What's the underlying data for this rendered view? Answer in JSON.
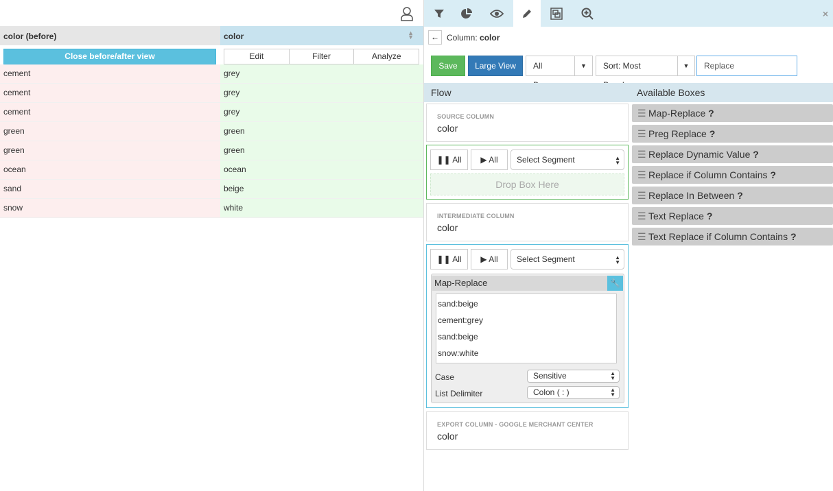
{
  "table": {
    "headers": [
      "color (before)",
      "color"
    ],
    "close_label": "Close before/after view",
    "actions": [
      "Edit",
      "Filter",
      "Analyze"
    ],
    "rows": [
      [
        "cement",
        "grey"
      ],
      [
        "cement",
        "grey"
      ],
      [
        "cement",
        "grey"
      ],
      [
        "green",
        "green"
      ],
      [
        "green",
        "green"
      ],
      [
        "ocean",
        "ocean"
      ],
      [
        "sand",
        "beige"
      ],
      [
        "snow",
        "white"
      ]
    ]
  },
  "panel": {
    "tabs": [
      "filter-icon",
      "pie-chart-icon",
      "eye-icon",
      "pencil-icon",
      "crop-icon",
      "zoom-in-icon"
    ],
    "close": "×",
    "column_label": "Column:",
    "column_name": "color",
    "save": "Save",
    "large_view": "Large View",
    "all_boxes": "All Boxes",
    "sort": "Sort: Most Popular",
    "search_value": "Replace",
    "flow": "Flow",
    "available": "Available Boxes",
    "source_label": "SOURCE COLUMN",
    "source_value": "color",
    "pause_all": "All",
    "play_all": "All",
    "select_segment": "Select Segment",
    "drop": "Drop Box Here",
    "intermediate_label": "INTERMEDIATE COLUMN",
    "intermediate_value": "color",
    "box_title": "Map-Replace",
    "map_lines": [
      "sand:beige",
      "cement:grey",
      "sand:beige",
      "snow:white"
    ],
    "case_label": "Case",
    "case_value": "Sensitive",
    "delim_label": "List Delimiter",
    "delim_value": "Colon ( : )",
    "export_label": "EXPORT COLUMN - GOOGLE MERCHANT CENTER",
    "export_value": "color",
    "boxes": [
      "Map-Replace",
      "Preg Replace",
      "Replace Dynamic Value",
      "Replace if Column Contains",
      "Replace In Between",
      "Text Replace",
      "Text Replace if Column Contains"
    ]
  },
  "colors": {
    "save": "#5cb85c",
    "primary": "#337ab7",
    "info": "#5bc0de"
  }
}
